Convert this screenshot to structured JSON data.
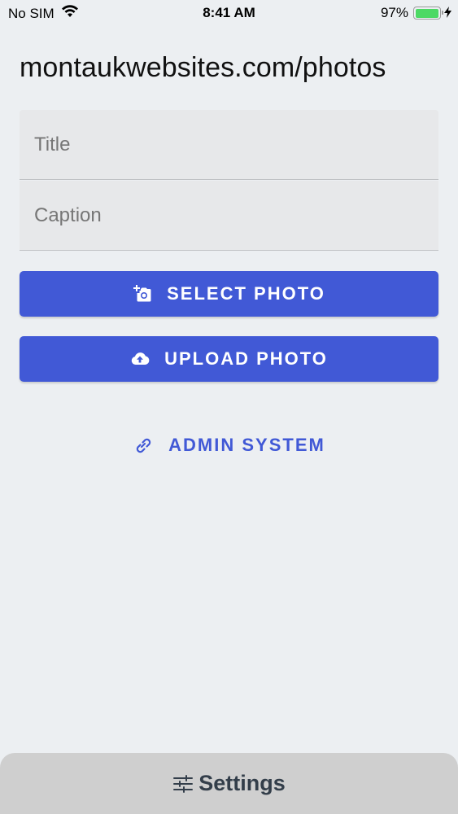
{
  "status_bar": {
    "carrier": "No SIM",
    "time": "8:41 AM",
    "battery_percent": "97%",
    "battery_level": 0.97,
    "icons": [
      "wifi-icon",
      "battery-icon",
      "charging-bolt-icon"
    ]
  },
  "page": {
    "title": "montaukwebsites.com/photos"
  },
  "form": {
    "title_placeholder": "Title",
    "title_value": "",
    "caption_placeholder": "Caption",
    "caption_value": "",
    "select_photo_label": "SELECT PHOTO",
    "upload_photo_label": "UPLOAD PHOTO"
  },
  "admin_link": {
    "label": "ADMIN SYSTEM"
  },
  "bottom_bar": {
    "settings_label": "Settings"
  },
  "colors": {
    "accent": "#4159d6",
    "background": "#eceff2",
    "field_background": "#e7e8ea",
    "bottom_bar": "#cfcfcf",
    "battery_fill": "#4cd964"
  }
}
